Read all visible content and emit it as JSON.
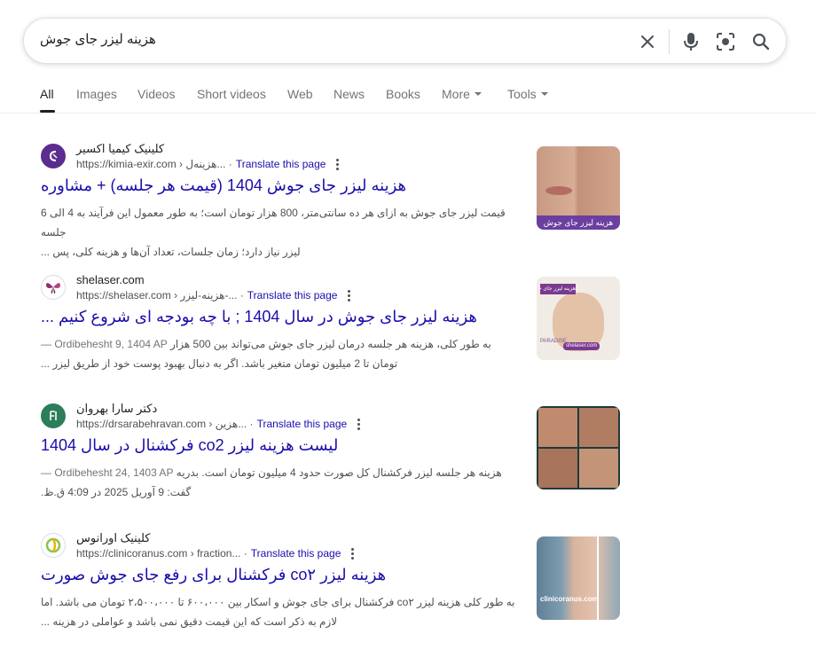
{
  "search": {
    "query": "هزینه لیزر جای جوش"
  },
  "tabs": [
    {
      "label": "All"
    },
    {
      "label": "Images"
    },
    {
      "label": "Videos"
    },
    {
      "label": "Short videos"
    },
    {
      "label": "Web"
    },
    {
      "label": "News"
    },
    {
      "label": "Books"
    },
    {
      "label": "More"
    },
    {
      "label": "Tools"
    }
  ],
  "results": [
    {
      "site_name": "کلینیک کیمیا اکسیر",
      "url": "https://kimia-exir.com",
      "crumb": "› هزینه‌ل...",
      "translate": "Translate this page",
      "title": "هزینه لیزر جای جوش 1404 (قیمت هر جلسه) + مشاوره",
      "snippet_line1": "قیمت لیزر جای جوش به ازای هر ده سانتی‌متر، 800 هزار تومان است؛ به طور معمول این فرآیند به 4 الی 6 جلسه",
      "snippet_line2": "لیزر نیاز دارد؛ زمان جلسات، تعداد آن‌ها و هزینه کلی، پس ...",
      "thumb_caption": "هزینه لیزر جای جوش"
    },
    {
      "site_name": "shelaser.com",
      "url": "https://shelaser.com",
      "crumb": "› هزینه-لیزر-...",
      "translate": "Translate this page",
      "title": "هزینه لیزر جای جوش در سال 1404 ; با چه بودجه ای شروع کنیم ...",
      "date": "Ordibehesht 9, 1404 AP —",
      "snippet_line1": "به طور کلی، هزینه هر جلسه درمان لیزر جای جوش می‌تواند بین 500 هزار",
      "snippet_line2": "تومان تا 2 میلیون تومان متغیر باشد. اگر به دنبال بهبود پوست خود از طریق لیزر ...",
      "thumb_caption": "shelaser.com",
      "thumb_tag": "هزینه لیزر جای جوش",
      "thumb_brand": "PARADISE"
    },
    {
      "site_name": "دکتر سارا بهروان",
      "url": "https://drsarabehravan.com",
      "crumb": "› هزین...",
      "translate": "Translate this page",
      "title": "لیست هزینه لیزر co2 فرکشنال در سال 1404",
      "date": "Ordibehesht 24, 1403 AP —",
      "snippet_line1": "هزینه هر جلسه لیزر فرکشنال کل صورت حدود 4 میلیون تومان است. بدریه",
      "snippet_line2": "گفت: 9 آوریل 2025 در 4:09 ق.ظ."
    },
    {
      "site_name": "کلینیک اورانوس",
      "url": "https://clinicoranus.com",
      "crumb": "› fraction...",
      "translate": "Translate this page",
      "title": "هزینه لیزر co۲ فرکشنال برای رفع جای جوش صورت",
      "snippet_line1": "به طور کلی هزینه لیزر co۲ فرکشنال برای جای جوش و اسکار بین ۶۰۰،۰۰۰ تا ۲،۵۰۰،۰۰۰ تومان می باشد. اما",
      "snippet_line2": "لازم به ذکر است که این قیمت دقیق نمی باشد و عواملی در هزینه ...",
      "thumb_caption": "clinicoranus.com"
    }
  ]
}
